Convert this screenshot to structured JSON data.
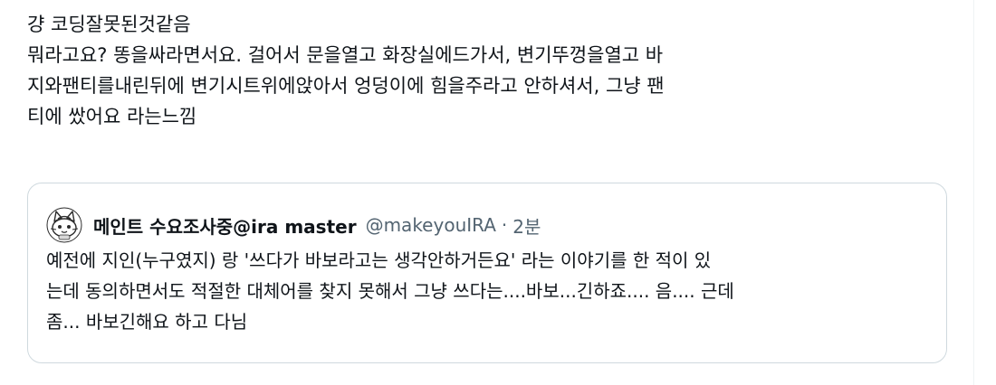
{
  "post": {
    "lines": [
      "걍 코딩잘못된것같음",
      "뭐라고요? 똥을싸라면서요. 걸어서 문을열고 화장실에드가서, 변기뚜껑을열고 바",
      "지와팬티를내린뒤에 변기시트위에앉아서 엉덩이에 힘을주라고 안하셔서, 그냥 팬",
      "티에 쌌어요 라는느낌"
    ]
  },
  "quoted_post": {
    "avatar_icon": "cartoon-cat-avatar-icon",
    "author_name": "메인트 수요조사중@ira master",
    "handle": "@makeyouIRA",
    "separator": "·",
    "time": "2분",
    "lines": [
      "예전에 지인(누구였지) 랑 '쓰다가 바보라고는 생각안하거든요' 라는 이야기를 한 적이 있",
      "는데 동의하면서도 적절한 대체어를 찾지 못해서 그냥 쓰다는....바보...긴하죠.... 음.... 근데",
      "좀... 바보긴해요 하고 다님"
    ]
  },
  "colors": {
    "text": "#0f1419",
    "secondary_text": "#536471",
    "border": "#cfd9de"
  }
}
